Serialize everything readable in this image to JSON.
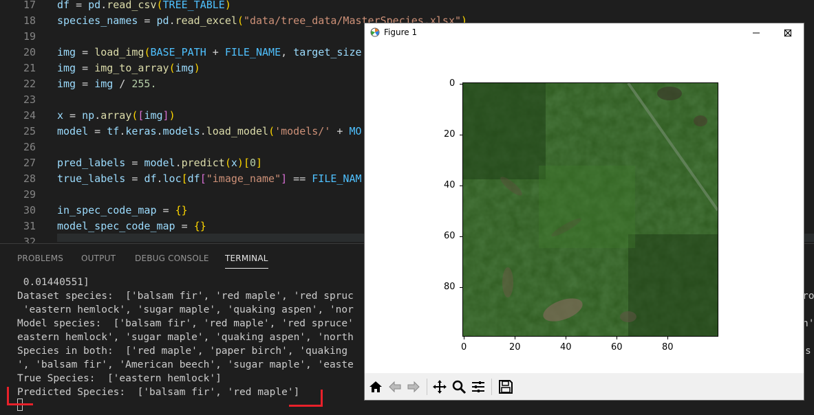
{
  "editor": {
    "lines": [
      {
        "num": "17",
        "tokens": [
          [
            "df",
            "var"
          ],
          [
            " = ",
            "op"
          ],
          [
            "pd",
            "var"
          ],
          [
            ".",
            "op"
          ],
          [
            "read_csv",
            "fn"
          ],
          [
            "(",
            "br2"
          ],
          [
            "TREE_TABLE",
            "const"
          ],
          [
            ")",
            "br2"
          ]
        ]
      },
      {
        "num": "18",
        "tokens": [
          [
            "species_names",
            "var"
          ],
          [
            " = ",
            "op"
          ],
          [
            "pd",
            "var"
          ],
          [
            ".",
            "op"
          ],
          [
            "read_excel",
            "fn"
          ],
          [
            "(",
            "br2"
          ],
          [
            "\"data/tree_data/MasterSpecies.xlsx\"",
            "str"
          ],
          [
            ")",
            "br2"
          ]
        ]
      },
      {
        "num": "19",
        "tokens": []
      },
      {
        "num": "20",
        "tokens": [
          [
            "img",
            "var"
          ],
          [
            " = ",
            "op"
          ],
          [
            "load_img",
            "fn"
          ],
          [
            "(",
            "br2"
          ],
          [
            "BASE_PATH",
            "const"
          ],
          [
            " + ",
            "op"
          ],
          [
            "FILE_NAME",
            "const"
          ],
          [
            ", ",
            "op"
          ],
          [
            "target_size",
            "var"
          ]
        ]
      },
      {
        "num": "21",
        "tokens": [
          [
            "img",
            "var"
          ],
          [
            " = ",
            "op"
          ],
          [
            "img_to_array",
            "fn"
          ],
          [
            "(",
            "br2"
          ],
          [
            "img",
            "var"
          ],
          [
            ")",
            "br2"
          ]
        ]
      },
      {
        "num": "22",
        "tokens": [
          [
            "img",
            "var"
          ],
          [
            " = ",
            "op"
          ],
          [
            "img",
            "var"
          ],
          [
            " / ",
            "op"
          ],
          [
            "255.",
            "num"
          ]
        ]
      },
      {
        "num": "23",
        "tokens": []
      },
      {
        "num": "24",
        "tokens": [
          [
            "x",
            "var"
          ],
          [
            " = ",
            "op"
          ],
          [
            "np",
            "var"
          ],
          [
            ".",
            "op"
          ],
          [
            "array",
            "fn"
          ],
          [
            "(",
            "br2"
          ],
          [
            "[",
            "br"
          ],
          [
            "img",
            "var"
          ],
          [
            "]",
            "br"
          ],
          [
            ")",
            "br2"
          ]
        ]
      },
      {
        "num": "25",
        "tokens": [
          [
            "model",
            "var"
          ],
          [
            " = ",
            "op"
          ],
          [
            "tf",
            "var"
          ],
          [
            ".",
            "op"
          ],
          [
            "keras",
            "var"
          ],
          [
            ".",
            "op"
          ],
          [
            "models",
            "var"
          ],
          [
            ".",
            "op"
          ],
          [
            "load_model",
            "fn"
          ],
          [
            "(",
            "br2"
          ],
          [
            "'models/'",
            "str"
          ],
          [
            " + ",
            "op"
          ],
          [
            "MO",
            "const"
          ]
        ]
      },
      {
        "num": "26",
        "tokens": []
      },
      {
        "num": "27",
        "tokens": [
          [
            "pred_labels",
            "var"
          ],
          [
            " = ",
            "op"
          ],
          [
            "model",
            "var"
          ],
          [
            ".",
            "op"
          ],
          [
            "predict",
            "fn"
          ],
          [
            "(",
            "br2"
          ],
          [
            "x",
            "var"
          ],
          [
            ")",
            "br2"
          ],
          [
            "[",
            "br2"
          ],
          [
            "0",
            "num"
          ],
          [
            "]",
            "br2"
          ]
        ]
      },
      {
        "num": "28",
        "tokens": [
          [
            "true_labels",
            "var"
          ],
          [
            " = ",
            "op"
          ],
          [
            "df",
            "var"
          ],
          [
            ".",
            "op"
          ],
          [
            "loc",
            "var"
          ],
          [
            "[",
            "br2"
          ],
          [
            "df",
            "var"
          ],
          [
            "[",
            "br"
          ],
          [
            "\"image_name\"",
            "str"
          ],
          [
            "]",
            "br"
          ],
          [
            " == ",
            "op"
          ],
          [
            "FILE_NAM",
            "const"
          ]
        ]
      },
      {
        "num": "29",
        "tokens": []
      },
      {
        "num": "30",
        "tokens": [
          [
            "in_spec_code_map",
            "var"
          ],
          [
            " = ",
            "op"
          ],
          [
            "{}",
            "br2"
          ]
        ]
      },
      {
        "num": "31",
        "tokens": [
          [
            "model_spec_code_map",
            "var"
          ],
          [
            " = ",
            "op"
          ],
          [
            "{}",
            "br2"
          ]
        ]
      },
      {
        "num": "32",
        "tokens": []
      }
    ],
    "right_edge_fragment": "es"
  },
  "panel": {
    "tabs": [
      {
        "label": "PROBLEMS",
        "active": false
      },
      {
        "label": "OUTPUT",
        "active": false
      },
      {
        "label": "DEBUG CONSOLE",
        "active": false
      },
      {
        "label": "TERMINAL",
        "active": true
      }
    ],
    "terminal_lines": [
      " 0.01440551]",
      "Dataset species:  ['balsam fir', 'red maple', 'red spruc",
      " 'eastern hemlock', 'sugar maple', 'quaking aspen', 'nor",
      "Model species:  ['balsam fir', 'red maple', 'red spruce'",
      "eastern hemlock', 'sugar maple', 'quaking aspen', 'north",
      "Species in both:  ['red maple', 'paper birch', 'quaking",
      "', 'balsam fir', 'American beech', 'sugar maple', 'easte",
      "True Species:  ['eastern hemlock']",
      "Predicted Species:  ['balsam fir', 'red maple']"
    ],
    "terminal_right_fragments": [
      {
        "row": 1,
        "text": "ro"
      },
      {
        "row": 3,
        "text": "h'"
      },
      {
        "row": 5,
        "text": "s"
      }
    ]
  },
  "figure": {
    "title": "Figure 1",
    "x_ticks": [
      "0",
      "20",
      "40",
      "60",
      "80"
    ],
    "y_ticks": [
      "0",
      "20",
      "40",
      "60",
      "80"
    ],
    "toolbar": [
      "home-icon",
      "back-icon",
      "forward-icon",
      "pan-icon",
      "zoom-icon",
      "configure-subplots-icon",
      "save-icon"
    ]
  },
  "colors": {
    "annotation_red": "#e8212a",
    "terminal_active_tab": "#e7e7e7"
  }
}
